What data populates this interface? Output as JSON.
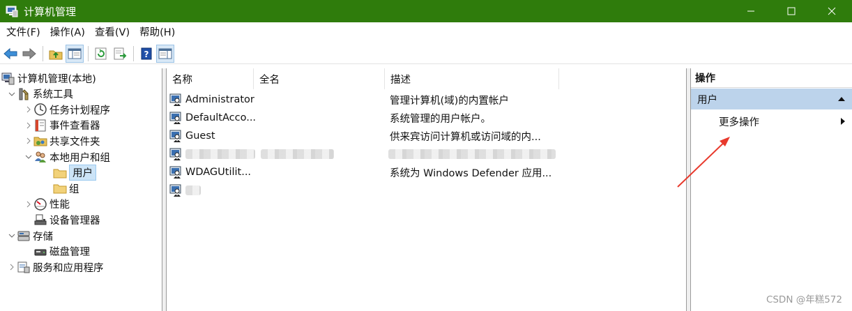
{
  "window": {
    "title": "计算机管理",
    "controls": [
      "minimize",
      "maximize",
      "close"
    ]
  },
  "menu": [
    "文件(F)",
    "操作(A)",
    "查看(V)",
    "帮助(H)"
  ],
  "toolbar": {
    "icons": [
      "back-icon",
      "forward-icon",
      "up-folder-icon",
      "show-hide-tree-icon",
      "refresh-icon",
      "export-list-icon",
      "help-icon",
      "properties-pane-icon"
    ]
  },
  "tree": [
    {
      "label": "计算机管理(本地)",
      "icon": "computer-management-icon",
      "level": 0,
      "expander": ""
    },
    {
      "label": "系统工具",
      "icon": "system-tools-icon",
      "level": 1,
      "expander": "open"
    },
    {
      "label": "任务计划程序",
      "icon": "clock-icon",
      "level": 2,
      "expander": "closed"
    },
    {
      "label": "事件查看器",
      "icon": "event-viewer-icon",
      "level": 2,
      "expander": "closed"
    },
    {
      "label": "共享文件夹",
      "icon": "shared-folder-icon",
      "level": 2,
      "expander": "closed"
    },
    {
      "label": "本地用户和组",
      "icon": "users-groups-icon",
      "level": 2,
      "expander": "open"
    },
    {
      "label": "用户",
      "icon": "folder-icon",
      "level": 3,
      "expander": "",
      "selected": true
    },
    {
      "label": "组",
      "icon": "folder-icon",
      "level": 3,
      "expander": ""
    },
    {
      "label": "性能",
      "icon": "performance-icon",
      "level": 2,
      "expander": "closed"
    },
    {
      "label": "设备管理器",
      "icon": "device-manager-icon",
      "level": 2,
      "expander": ""
    },
    {
      "label": "存储",
      "icon": "storage-icon",
      "level": 1,
      "expander": "open"
    },
    {
      "label": "磁盘管理",
      "icon": "disk-management-icon",
      "level": 2,
      "expander": ""
    },
    {
      "label": "服务和应用程序",
      "icon": "services-icon",
      "level": 1,
      "expander": "closed"
    }
  ],
  "list": {
    "columns": [
      "名称",
      "全名",
      "描述"
    ],
    "rows": [
      {
        "name": "Administrator",
        "fullname": "",
        "desc": "管理计算机(域)的内置帐户"
      },
      {
        "name": "DefaultAcco...",
        "fullname": "",
        "desc": "系统管理的用户帐户。"
      },
      {
        "name": "Guest",
        "fullname": "",
        "desc": "供来宾访问计算机或访问域的内..."
      },
      {
        "name": "",
        "fullname": "",
        "desc": "",
        "blurred": true
      },
      {
        "name": "WDAGUtilit...",
        "fullname": "",
        "desc": "系统为 Windows Defender 应用..."
      },
      {
        "name": "",
        "fullname": "",
        "desc": "",
        "blurred": true,
        "blur_name_only": true
      }
    ]
  },
  "actions": {
    "title": "操作",
    "section": "用户",
    "items": [
      "更多操作"
    ]
  },
  "watermark": "CSDN @年糕572",
  "colors": {
    "titlebar": "#2f7c0c",
    "section": "#bcd3eb",
    "selection": "#cce4f7",
    "arrow": "#e8392c"
  }
}
